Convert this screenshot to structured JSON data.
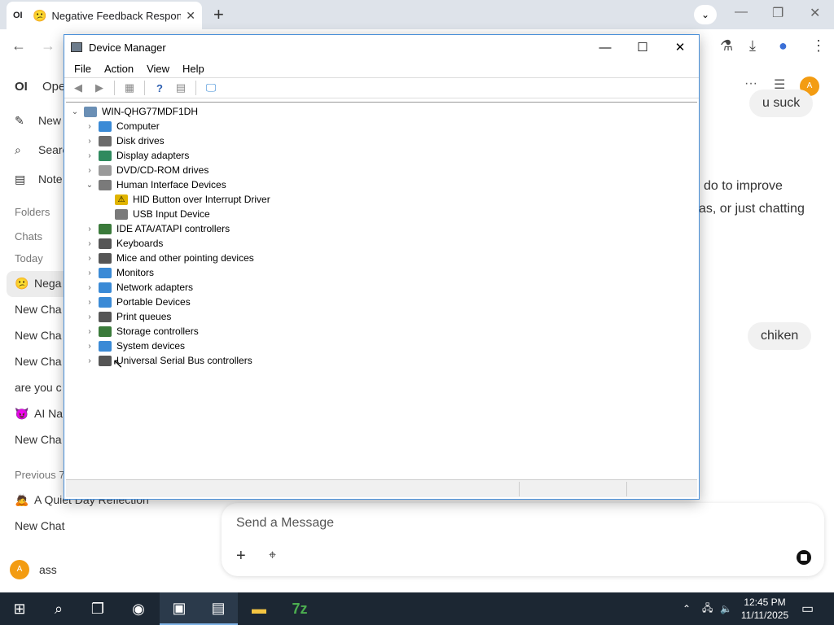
{
  "browser": {
    "tab_favicon": "OI",
    "tab_emoji": "😕",
    "tab_title": "Negative Feedback Respon",
    "tab_close": "✕",
    "new_tab": "+",
    "tab_search": "⌄",
    "minimize": "—",
    "restore": "❐",
    "close": "✕",
    "back": "←",
    "forward": "→"
  },
  "app": {
    "logo": "OI",
    "logo_text": "Ope",
    "new_chat": "New",
    "search": "Searc",
    "notes": "Note",
    "section_folders": "Folders",
    "section_chats": "Chats",
    "section_today": "Today",
    "chats_today": [
      {
        "emoji": "😕",
        "label": "Nega"
      },
      {
        "emoji": "",
        "label": "New Cha"
      },
      {
        "emoji": "",
        "label": "New Cha"
      },
      {
        "emoji": "",
        "label": "New Cha"
      },
      {
        "emoji": "",
        "label": "are you c"
      },
      {
        "emoji": "😈",
        "label": "AI Na"
      },
      {
        "emoji": "",
        "label": "New Cha"
      }
    ],
    "section_previous": "Previous 7",
    "chats_previous": [
      {
        "emoji": "🙇",
        "label": "A Quiet Day Reflection"
      },
      {
        "emoji": "",
        "label": "New Chat"
      }
    ],
    "user_initial": "A",
    "user_name": "ass",
    "bubble_1": "u suck",
    "assistant_line_1": "do to improve",
    "assistant_line_2": "as, or just chatting",
    "bubble_2": "chiken",
    "input_placeholder": "Send a Message",
    "header_more": "···",
    "header_settings": "☰",
    "header_avatar": "A"
  },
  "device_manager": {
    "title": "Device Manager",
    "menu": [
      "File",
      "Action",
      "View",
      "Help"
    ],
    "root": "WIN-QHG77MDF1DH",
    "nodes": [
      {
        "label": "Computer",
        "expanded": false,
        "icon_color": "#3a8ad6"
      },
      {
        "label": "Disk drives",
        "expanded": false,
        "icon_color": "#6b6b6b"
      },
      {
        "label": "Display adapters",
        "expanded": false,
        "icon_color": "#2f8a5e"
      },
      {
        "label": "DVD/CD-ROM drives",
        "expanded": false,
        "icon_color": "#9a9a9a"
      },
      {
        "label": "Human Interface Devices",
        "expanded": true,
        "icon_color": "#7a7a7a"
      },
      {
        "label": "HID Button over Interrupt Driver",
        "child": true,
        "warning": true,
        "icon_color": "#e0b400"
      },
      {
        "label": "USB Input Device",
        "child": true,
        "icon_color": "#7a7a7a"
      },
      {
        "label": "IDE ATA/ATAPI controllers",
        "expanded": false,
        "icon_color": "#3a7a3a"
      },
      {
        "label": "Keyboards",
        "expanded": false,
        "icon_color": "#555555"
      },
      {
        "label": "Mice and other pointing devices",
        "expanded": false,
        "icon_color": "#555555"
      },
      {
        "label": "Monitors",
        "expanded": false,
        "icon_color": "#3a8ad6"
      },
      {
        "label": "Network adapters",
        "expanded": false,
        "icon_color": "#3a8ad6"
      },
      {
        "label": "Portable Devices",
        "expanded": false,
        "icon_color": "#3a8ad6"
      },
      {
        "label": "Print queues",
        "expanded": false,
        "icon_color": "#555555"
      },
      {
        "label": "Storage controllers",
        "expanded": false,
        "icon_color": "#3a7a3a"
      },
      {
        "label": "System devices",
        "expanded": false,
        "icon_color": "#3a8ad6"
      },
      {
        "label": "Universal Serial Bus controllers",
        "expanded": false,
        "icon_color": "#555555"
      }
    ]
  },
  "taskbar": {
    "time": "12:45 PM",
    "date": "11/11/2025"
  }
}
